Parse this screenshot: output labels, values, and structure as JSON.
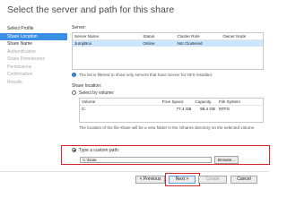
{
  "page": {
    "title": "Select the server and path for this share"
  },
  "nav": {
    "items": [
      {
        "label": "Select Profile",
        "state": "done"
      },
      {
        "label": "Share Location",
        "state": "active"
      },
      {
        "label": "Share Name",
        "state": "done"
      },
      {
        "label": "Authentication",
        "state": "disabled"
      },
      {
        "label": "Share Permissions",
        "state": "disabled"
      },
      {
        "label": "Permissions",
        "state": "disabled"
      },
      {
        "label": "Confirmation",
        "state": "disabled"
      },
      {
        "label": "Results",
        "state": "disabled"
      }
    ]
  },
  "server": {
    "label": "Server:",
    "columns": [
      "Server Name",
      "Status",
      "Cluster Role",
      "Owner Node"
    ],
    "rows": [
      {
        "name": "JumpBox",
        "status": "Online",
        "role": "Not Clustered",
        "owner": ""
      }
    ]
  },
  "filter_note": "The list is filtered to show only servers that have Server for NFS installed.",
  "share_location": {
    "label": "Share location:",
    "by_volume_label": "Select by volume:",
    "columns": [
      "Volume",
      "Free Space",
      "Capacity",
      "File System"
    ],
    "rows": [
      {
        "volume": "C:",
        "free": "77.4 GB",
        "capacity": "98.4 GB",
        "fs": "NTFS"
      }
    ],
    "note": "The location of the file share will be a new folder in the \\Shares directory on the selected volume.",
    "custom_path_label": "Type a custom path:",
    "custom_path_value": "C:\\Data",
    "browse_label": "Browse...",
    "selected_option": "custom"
  },
  "footer": {
    "previous": "< Previous",
    "next": "Next >",
    "create": "Create",
    "cancel": "Cancel"
  },
  "colors": {
    "accent": "#3a8ee6",
    "highlight": "#d4262b",
    "selected_row": "#cce6ff"
  }
}
